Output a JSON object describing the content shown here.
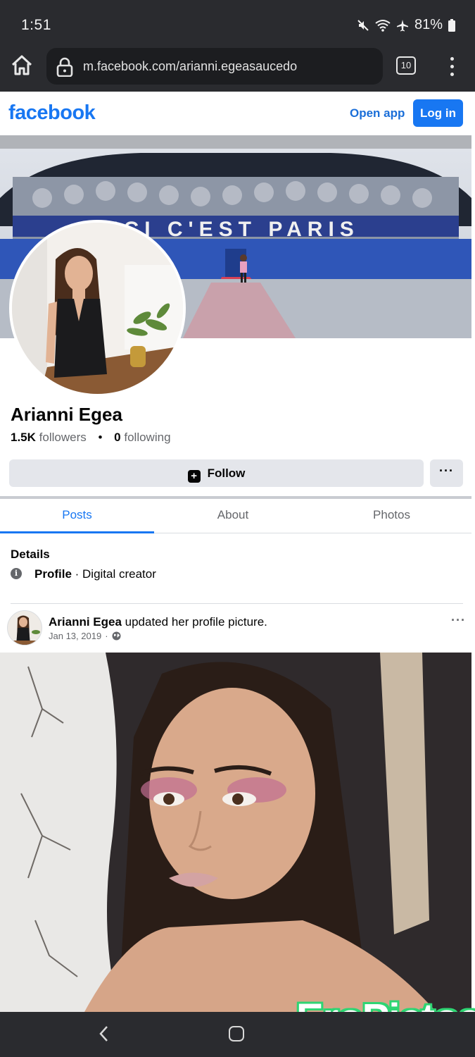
{
  "status_bar": {
    "time": "1:51",
    "battery": "81%"
  },
  "browser": {
    "url": "m.facebook.com/arianni.egeasaucedo",
    "tab_count": "10"
  },
  "fb_header": {
    "logo": "facebook",
    "open_app": "Open app",
    "login": "Log in"
  },
  "cover": {
    "banner_text": "ICI C'EST PARIS"
  },
  "profile": {
    "name": "Arianni Egea",
    "followers_count": "1.5K",
    "followers_label": "followers",
    "following_count": "0",
    "following_label": "following",
    "follow_label": "Follow",
    "more_label": "···"
  },
  "tabs": [
    {
      "label": "Posts",
      "active": true
    },
    {
      "label": "About",
      "active": false
    },
    {
      "label": "Photos",
      "active": false
    }
  ],
  "details": {
    "title": "Details",
    "label": "Profile",
    "value": "· Digital creator"
  },
  "post": {
    "author": "Arianni Egea",
    "action": " updated her profile picture.",
    "date": "Jan 13, 2019",
    "dot": "·",
    "more": "···"
  },
  "watermark": "EroPictoa",
  "colors": {
    "brand": "#1877f2",
    "system_bar": "#2a2b2f",
    "button_gray": "#e4e6eb"
  },
  "icons": [
    "home-icon",
    "lock-icon",
    "tabs-icon",
    "menu-icon",
    "info-icon",
    "globe-icon",
    "back-icon",
    "home-nav-icon"
  ]
}
